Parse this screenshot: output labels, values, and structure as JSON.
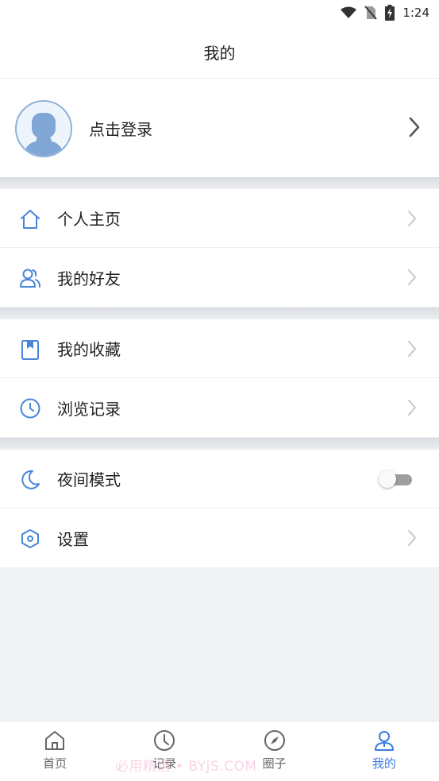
{
  "status_bar": {
    "time": "1:24"
  },
  "header": {
    "title": "我的"
  },
  "profile": {
    "login_label": "点击登录"
  },
  "sections": [
    {
      "items": [
        {
          "label": "个人主页",
          "icon": "home-icon"
        },
        {
          "label": "我的好友",
          "icon": "friends-icon"
        }
      ]
    },
    {
      "items": [
        {
          "label": "我的收藏",
          "icon": "bookmark-icon"
        },
        {
          "label": "浏览记录",
          "icon": "clock-icon"
        }
      ]
    },
    {
      "items": [
        {
          "label": "夜间模式",
          "icon": "moon-icon",
          "toggle": false
        },
        {
          "label": "设置",
          "icon": "settings-hexagon-icon"
        }
      ]
    }
  ],
  "bottom_nav": {
    "items": [
      {
        "label": "首页",
        "icon": "home-icon"
      },
      {
        "label": "记录",
        "icon": "clock-icon"
      },
      {
        "label": "圈子",
        "icon": "compass-icon"
      },
      {
        "label": "我的",
        "icon": "user-icon",
        "active": true
      }
    ]
  },
  "watermark": "必用精选 • BYJS.COM",
  "colors": {
    "accent": "#3a7de0",
    "icon_blue": "#4a86d8",
    "avatar_fill": "#7fa6d4",
    "toggle_track": "#9e9e9e"
  }
}
